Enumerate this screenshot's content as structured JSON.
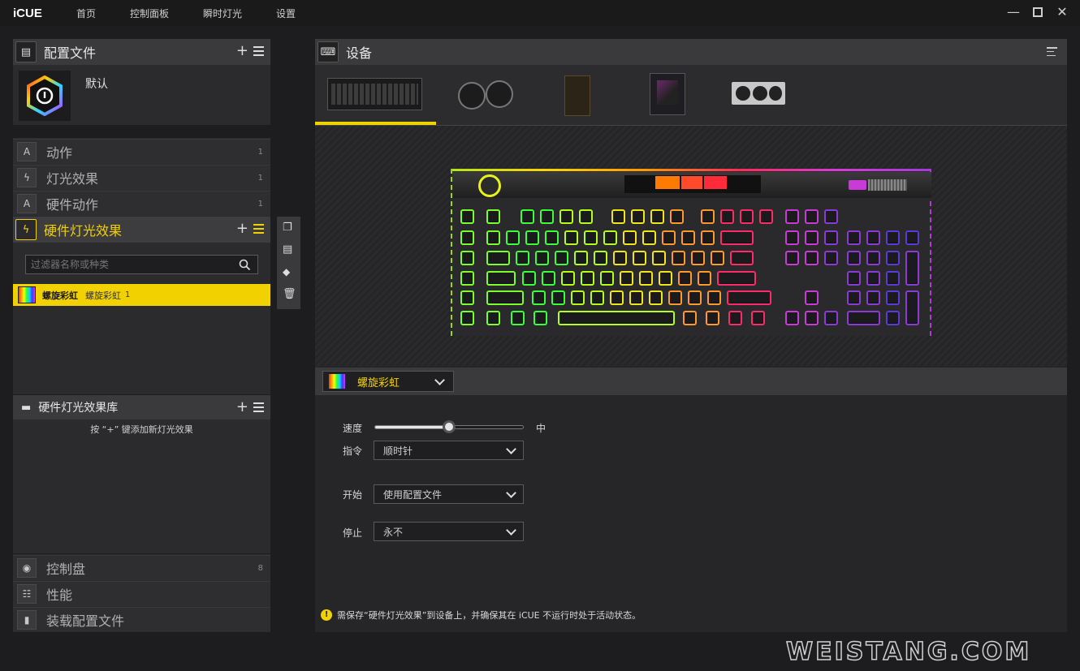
{
  "app": {
    "name": "iCUE",
    "nav": [
      "首页",
      "控制面板",
      "瞬时灯光",
      "设置"
    ]
  },
  "profiles": {
    "title": "配置文件",
    "current": "默认"
  },
  "sections": [
    {
      "label": "动作",
      "count": "1",
      "icon": "letter-a-icon"
    },
    {
      "label": "灯光效果",
      "count": "1",
      "icon": "lightning-icon"
    },
    {
      "label": "硬件动作",
      "count": "1",
      "icon": "letter-a-icon"
    }
  ],
  "hw_lighting": {
    "title": "硬件灯光效果",
    "filter_placeholder": "过滤器名称或种类",
    "effect_name": "螺旋彩虹",
    "effect_type": "螺旋彩虹",
    "effect_count": "1"
  },
  "library": {
    "title": "硬件灯光效果库",
    "hint": "按 “+” 键添加新灯光效果"
  },
  "bottom_sections": [
    {
      "label": "控制盘",
      "count": "8",
      "icon": "dial-icon"
    },
    {
      "label": "性能",
      "count": "",
      "icon": "performance-icon"
    },
    {
      "label": "装载配置文件",
      "count": "",
      "icon": "onboard-icon"
    }
  ],
  "devices": {
    "title": "设备",
    "items": [
      "keyboard",
      "cooler",
      "controller",
      "motherboard",
      "gpu"
    ]
  },
  "effect_panel": {
    "selected_effect": "螺旋彩虹",
    "speed_label": "速度",
    "speed_value_label": "中",
    "speed_level": 0.5,
    "direction_label": "指令",
    "direction_value": "顺时针",
    "start_label": "开始",
    "start_value": "使用配置文件",
    "stop_label": "停止",
    "stop_value": "永不",
    "notice": "需保存“硬件灯光效果”到设备上，并确保其在 iCUE 不运行时处于活动状态。"
  },
  "watermark": "WEISTANG.COM",
  "colors": {
    "accent": "#f2d100",
    "panel": "#2b2b2d",
    "header": "#3a3a3d"
  }
}
